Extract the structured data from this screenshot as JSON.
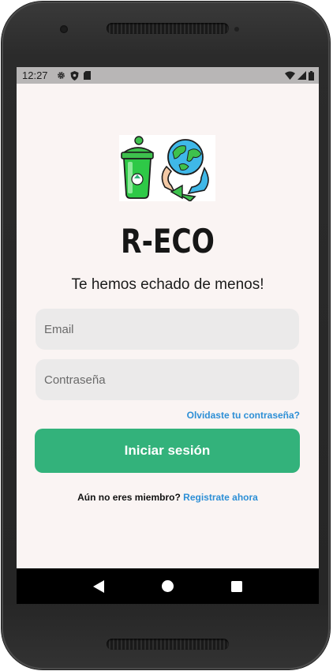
{
  "status_bar": {
    "time": "12:27",
    "left_icons": [
      "gear-icon",
      "shield-icon",
      "sd-card-icon"
    ],
    "right_icons": [
      "wifi-icon",
      "signal-icon",
      "battery-icon"
    ]
  },
  "app": {
    "title": "R-ECO",
    "subtitle": "Te hemos echado de menos!"
  },
  "form": {
    "email_placeholder": "Email",
    "password_placeholder": "Contraseña",
    "forgot_password": "Olvidaste tu contraseña?",
    "login_button": "Iniciar sesión",
    "register_question": "Aún no eres miembro?",
    "register_link": "Registrate ahora"
  },
  "colors": {
    "accent": "#33b27b",
    "link": "#2d8fd6",
    "screen_background": "#faf4f3",
    "field_background": "#ebeaea"
  },
  "nav_bar": {
    "buttons": [
      "back-icon",
      "home-icon",
      "recents-icon"
    ]
  }
}
